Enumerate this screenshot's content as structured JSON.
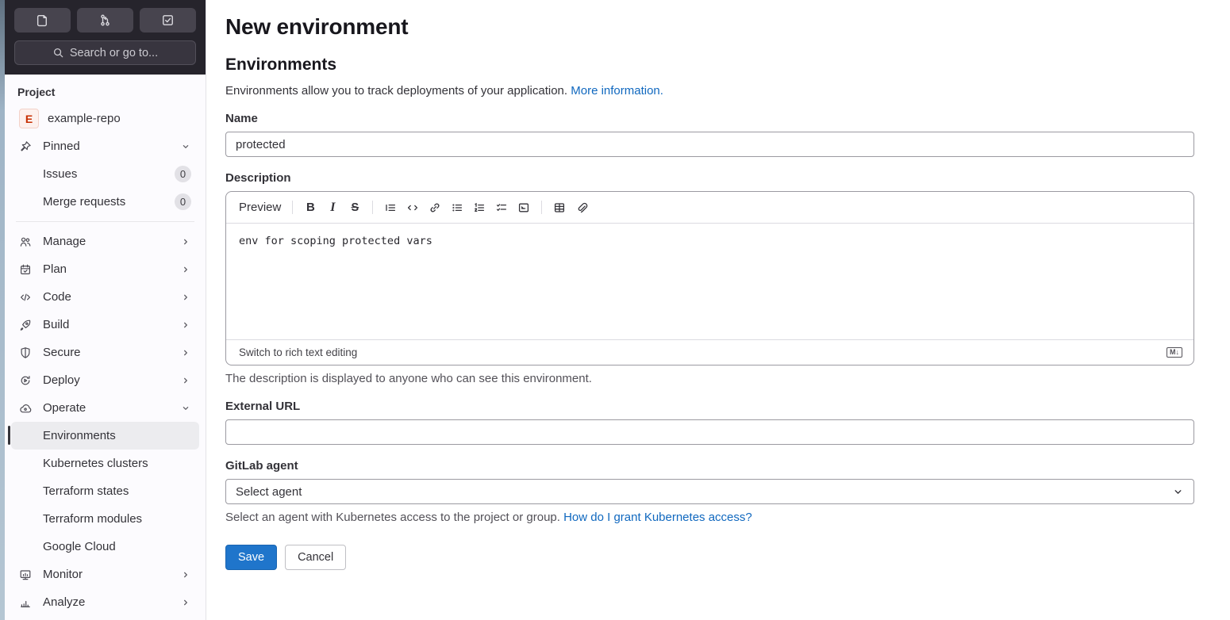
{
  "colors": {
    "accent_blue": "#1f75cb",
    "link_blue": "#1068bf",
    "dark_panel": "#26242c",
    "active_item_bg": "#ececef"
  },
  "topbar": {
    "shortcuts": [
      {
        "icon": "issues-icon"
      },
      {
        "icon": "merge-request-icon"
      },
      {
        "icon": "todo-check-icon"
      }
    ],
    "search": {
      "placeholder": "Search or go to...",
      "icon": "search-icon"
    }
  },
  "sidebar": {
    "section_label": "Project",
    "project": {
      "avatar_letter": "E",
      "name": "example-repo"
    },
    "pinned": {
      "label": "Pinned",
      "icon": "pin-icon",
      "chevron": "down"
    },
    "pinned_items": [
      {
        "label": "Issues",
        "badge": "0"
      },
      {
        "label": "Merge requests",
        "badge": "0"
      }
    ],
    "nav": [
      {
        "label": "Manage",
        "icon": "users-icon",
        "chevron": "right"
      },
      {
        "label": "Plan",
        "icon": "calendar-icon",
        "chevron": "right"
      },
      {
        "label": "Code",
        "icon": "code-icon",
        "chevron": "right"
      },
      {
        "label": "Build",
        "icon": "rocket-icon",
        "chevron": "right"
      },
      {
        "label": "Secure",
        "icon": "shield-icon",
        "chevron": "right"
      },
      {
        "label": "Deploy",
        "icon": "deploy-icon",
        "chevron": "right"
      },
      {
        "label": "Operate",
        "icon": "cloud-icon",
        "chevron": "down"
      }
    ],
    "operate_children": [
      {
        "label": "Environments",
        "active": true
      },
      {
        "label": "Kubernetes clusters"
      },
      {
        "label": "Terraform states"
      },
      {
        "label": "Terraform modules"
      },
      {
        "label": "Google Cloud"
      }
    ],
    "nav_after": [
      {
        "label": "Monitor",
        "icon": "monitor-icon",
        "chevron": "right"
      },
      {
        "label": "Analyze",
        "icon": "chart-icon",
        "chevron": "right"
      }
    ]
  },
  "main": {
    "page_title": "New environment",
    "section_title": "Environments",
    "intro_text": "Environments allow you to track deployments of your application. ",
    "intro_link": "More information.",
    "name": {
      "label": "Name",
      "value": "protected"
    },
    "description": {
      "label": "Description",
      "preview_label": "Preview",
      "toolbar_icons": [
        "bold-icon",
        "italic-icon",
        "strikethrough-icon",
        "quote-icon",
        "code-icon",
        "link-icon",
        "bullet-list-icon",
        "numbered-list-icon",
        "task-list-icon",
        "collapsible-section-icon",
        "table-icon",
        "attachment-icon"
      ],
      "value": "env for scoping protected vars",
      "switch_label": "Switch to rich text editing",
      "markdown_icon": "markdown-icon",
      "help": "The description is displayed to anyone who can see this environment."
    },
    "external_url": {
      "label": "External URL",
      "value": ""
    },
    "agent": {
      "label": "GitLab agent",
      "selected": "Select agent",
      "chevron_icon": "chevron-down-icon",
      "help": "Select an agent with Kubernetes access to the project or group. ",
      "help_link": "How do I grant Kubernetes access?"
    },
    "actions": {
      "save": "Save",
      "cancel": "Cancel"
    }
  }
}
